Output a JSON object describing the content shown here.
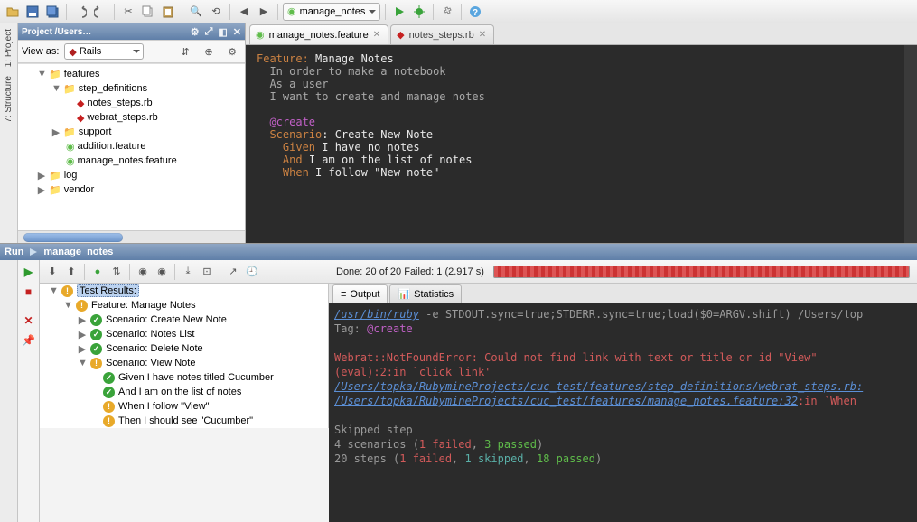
{
  "toolbar": {
    "run_config_icon": "feature",
    "run_config_label": "manage_notes"
  },
  "project_panel": {
    "title": "Project /Users…",
    "view_as_label": "View as:",
    "rails_label": "Rails",
    "tree": {
      "root": "features",
      "step_defs": "step_definitions",
      "notes_steps": "notes_steps.rb",
      "webrat_steps": "webrat_steps.rb",
      "support": "support",
      "addition": "addition.feature",
      "manage_notes": "manage_notes.feature",
      "log": "log",
      "vendor": "vendor"
    }
  },
  "rails": {
    "project_tab": "1: Project",
    "structure_tab": "7: Structure"
  },
  "editor": {
    "tabs": {
      "t1": "manage_notes.feature",
      "t2": "notes_steps.rb"
    },
    "lines": {
      "l1a": "Feature:",
      "l1b": " Manage Notes",
      "l2": "In order to make a notebook",
      "l3": "As a user",
      "l4": "I want to create and manage notes",
      "l5": "@create",
      "l6a": "Scenario",
      "l6b": ": Create New Note",
      "l7a": "Given",
      "l7b": " I have no notes",
      "l8a": "And",
      "l8b": " I am on the list of notes",
      "l9a": "When",
      "l9b": " I follow ",
      "l9c": "\"New note\""
    }
  },
  "run": {
    "header_label": "Run",
    "header_config": "manage_notes",
    "summary": "Done: 20 of 20  Failed: 1  (2.917 s)",
    "out_tab1": "Output",
    "out_tab2": "Statistics",
    "test_tree": {
      "root": "Test Results:",
      "feature": "Feature: Manage Notes",
      "s1": "Scenario: Create New Note",
      "s2": "Scenario: Notes List",
      "s3": "Scenario: Delete Note",
      "s4": "Scenario: View Note",
      "step1": "Given I have notes titled Cucumber",
      "step2": "And I am on the list of notes",
      "step3": "When I follow \"View\"",
      "step4": "Then I should see \"Cucumber\""
    },
    "console": {
      "ln1a": "/usr/bin/ruby",
      "ln1b": " -e STDOUT.sync=true;STDERR.sync=true;load($0=ARGV.shift) /Users/top",
      "ln2a": "Tag: ",
      "ln2b": "@create",
      "ln3": "Webrat::NotFoundError: Could not find link with text or title or id \"View\"",
      "ln4": "(eval):2:in `click_link'",
      "ln5": "/Users/topka/RubymineProjects/cuc_test/features/step_definitions/webrat_steps.rb:",
      "ln6a": "/Users/topka/RubymineProjects/cuc_test/features/manage_notes.feature:32",
      "ln6b": ":in `When ",
      "ln7": "Skipped step",
      "ln8a": "4 scenarios (",
      "ln8b": "1 failed",
      "ln8c": ", ",
      "ln8d": "3 passed",
      "ln8e": ")",
      "ln9a": "20 steps (",
      "ln9b": "1 failed",
      "ln9c": ", ",
      "ln9d": "1 skipped",
      "ln9e": ", ",
      "ln9f": "18 passed",
      "ln9g": ")"
    }
  }
}
